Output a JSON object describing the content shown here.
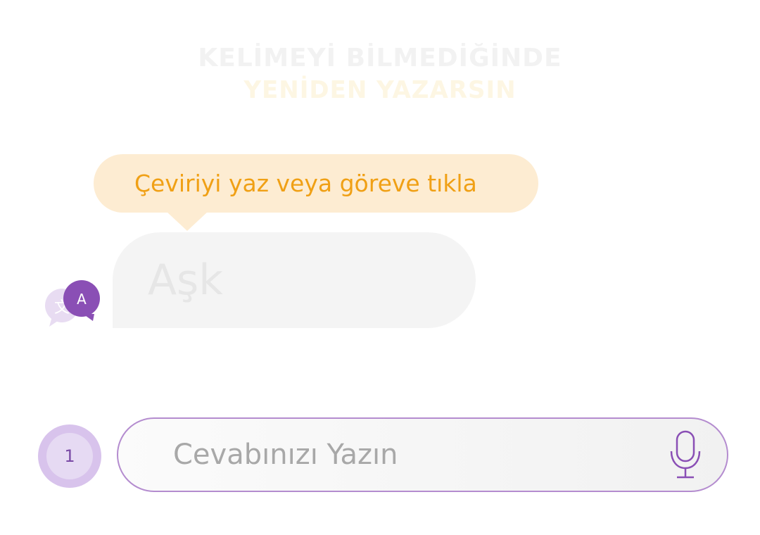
{
  "heading": {
    "line1": "KELİMEYİ BİLMEDİĞİNDE",
    "line2": "YENİDEN YAZARSIN"
  },
  "tooltip": {
    "text": "Çeviriyi yaz veya göreve tıkla"
  },
  "word": {
    "text": "Aşk"
  },
  "translate_icon": {
    "name": "translate-icon",
    "front_letter": "A",
    "back_letter": "文"
  },
  "answer": {
    "placeholder": "Cevabınızı Yazın",
    "mic_icon": "microphone-icon"
  },
  "counter": {
    "value": "1"
  },
  "colors": {
    "tooltip_bg": "#fdecd2",
    "tooltip_text": "#f0a015",
    "accent_purple": "#8a4fb5",
    "input_border": "#b48ccf"
  }
}
